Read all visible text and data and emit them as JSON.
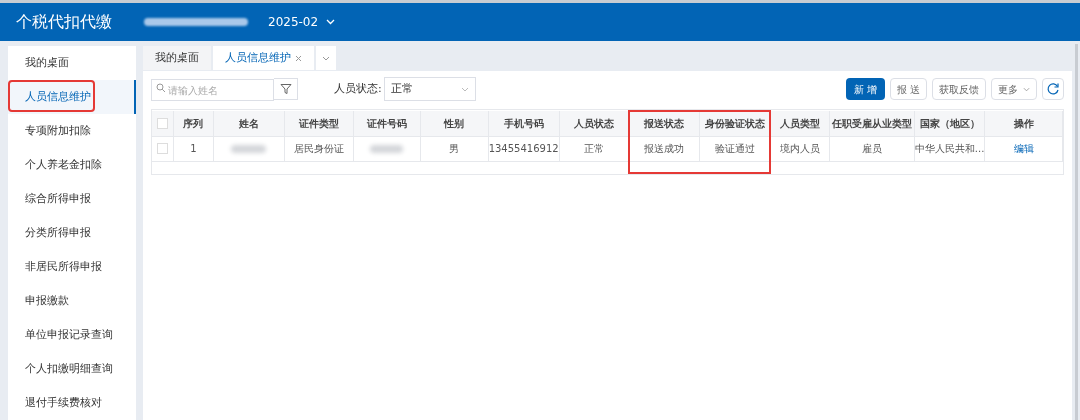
{
  "header": {
    "app_title": "个税代扣代缴",
    "period": "2025-02"
  },
  "sidebar": {
    "items": [
      {
        "label": "我的桌面",
        "selected": false,
        "highlighted": false
      },
      {
        "label": "人员信息维护",
        "selected": true,
        "highlighted": true
      },
      {
        "label": "专项附加扣除",
        "selected": false,
        "highlighted": false
      },
      {
        "label": "个人养老金扣除",
        "selected": false,
        "highlighted": false
      },
      {
        "label": "综合所得申报",
        "selected": false,
        "highlighted": false
      },
      {
        "label": "分类所得申报",
        "selected": false,
        "highlighted": false
      },
      {
        "label": "非居民所得申报",
        "selected": false,
        "highlighted": false
      },
      {
        "label": "申报缴款",
        "selected": false,
        "highlighted": false
      },
      {
        "label": "单位申报记录查询",
        "selected": false,
        "highlighted": false
      },
      {
        "label": "个人扣缴明细查询",
        "selected": false,
        "highlighted": false
      },
      {
        "label": "退付手续费核对",
        "selected": false,
        "highlighted": false
      }
    ]
  },
  "tabs": [
    {
      "label": "我的桌面",
      "selected": false,
      "closable": false
    },
    {
      "label": "人员信息维护",
      "selected": true,
      "closable": true
    }
  ],
  "toolbar": {
    "search_placeholder": "请输入姓名",
    "status_label": "人员状态:",
    "status_value": "正常",
    "buttons": [
      {
        "label": "新 增",
        "kind": "primary"
      },
      {
        "label": "报 送",
        "kind": "default"
      },
      {
        "label": "获取反馈",
        "kind": "default"
      },
      {
        "label": "更多",
        "kind": "dropdown"
      },
      {
        "kind": "refresh"
      }
    ]
  },
  "table": {
    "select_all_checked": false,
    "columns": [
      {
        "label": "序列",
        "highlighted": false
      },
      {
        "label": "姓名",
        "highlighted": false
      },
      {
        "label": "证件类型",
        "highlighted": false
      },
      {
        "label": "证件号码",
        "highlighted": false
      },
      {
        "label": "性别",
        "highlighted": false
      },
      {
        "label": "手机号码",
        "highlighted": false
      },
      {
        "label": "人员状态",
        "highlighted": false
      },
      {
        "label": "报送状态",
        "highlighted": true
      },
      {
        "label": "身份验证状态",
        "highlighted": true
      },
      {
        "label": "人员类型",
        "highlighted": false
      },
      {
        "label": "任职受雇从业类型",
        "highlighted": false
      },
      {
        "label": "国家（地区）",
        "highlighted": false
      },
      {
        "label": "操作",
        "highlighted": false
      }
    ],
    "rows": [
      {
        "checked": false,
        "cells": [
          {
            "kind": "text",
            "text": "1"
          },
          {
            "kind": "redacted"
          },
          {
            "kind": "text",
            "text": "居民身份证"
          },
          {
            "kind": "redacted"
          },
          {
            "kind": "text",
            "text": "男"
          },
          {
            "kind": "text",
            "text": "13455416912"
          },
          {
            "kind": "text",
            "text": "正常"
          },
          {
            "kind": "text",
            "text": "报送成功"
          },
          {
            "kind": "text",
            "text": "验证通过"
          },
          {
            "kind": "text",
            "text": "境内人员"
          },
          {
            "kind": "text",
            "text": "雇员"
          },
          {
            "kind": "text",
            "text": "中华人民共和..."
          },
          {
            "kind": "link",
            "text": "编辑"
          }
        ]
      }
    ]
  }
}
